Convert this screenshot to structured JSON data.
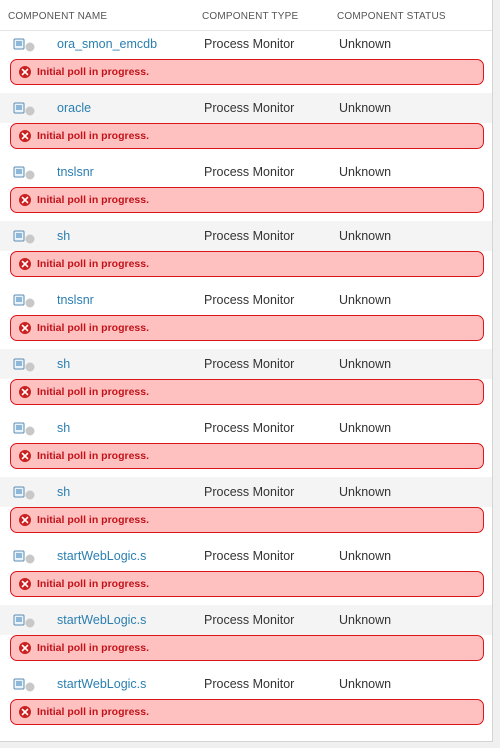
{
  "table": {
    "columns": {
      "name": "COMPONENT NAME",
      "type": "COMPONENT TYPE",
      "status": "COMPONENT STATUS"
    },
    "rows": [
      {
        "name": "ora_smon_emcdb",
        "type": "Process Monitor",
        "status": "Unknown",
        "message": "Initial poll in progress."
      },
      {
        "name": "oracle",
        "type": "Process Monitor",
        "status": "Unknown",
        "message": "Initial poll in progress."
      },
      {
        "name": "tnslsnr",
        "type": "Process Monitor",
        "status": "Unknown",
        "message": "Initial poll in progress."
      },
      {
        "name": "sh",
        "type": "Process Monitor",
        "status": "Unknown",
        "message": "Initial poll in progress."
      },
      {
        "name": "tnslsnr",
        "type": "Process Monitor",
        "status": "Unknown",
        "message": "Initial poll in progress."
      },
      {
        "name": "sh",
        "type": "Process Monitor",
        "status": "Unknown",
        "message": "Initial poll in progress."
      },
      {
        "name": "sh",
        "type": "Process Monitor",
        "status": "Unknown",
        "message": "Initial poll in progress."
      },
      {
        "name": "sh",
        "type": "Process Monitor",
        "status": "Unknown",
        "message": "Initial poll in progress."
      },
      {
        "name": "startWebLogic.s",
        "type": "Process Monitor",
        "status": "Unknown",
        "message": "Initial poll in progress."
      },
      {
        "name": "startWebLogic.s",
        "type": "Process Monitor",
        "status": "Unknown",
        "message": "Initial poll in progress."
      },
      {
        "name": "startWebLogic.s",
        "type": "Process Monitor",
        "status": "Unknown",
        "message": "Initial poll in progress."
      }
    ]
  },
  "icons": {
    "component": "process-monitor-icon",
    "error": "error-x-icon"
  },
  "colors": {
    "link": "#2a7fb0",
    "error_bg": "#ffc0c0",
    "error_border": "#d9161b",
    "error_text": "#c0141b"
  }
}
